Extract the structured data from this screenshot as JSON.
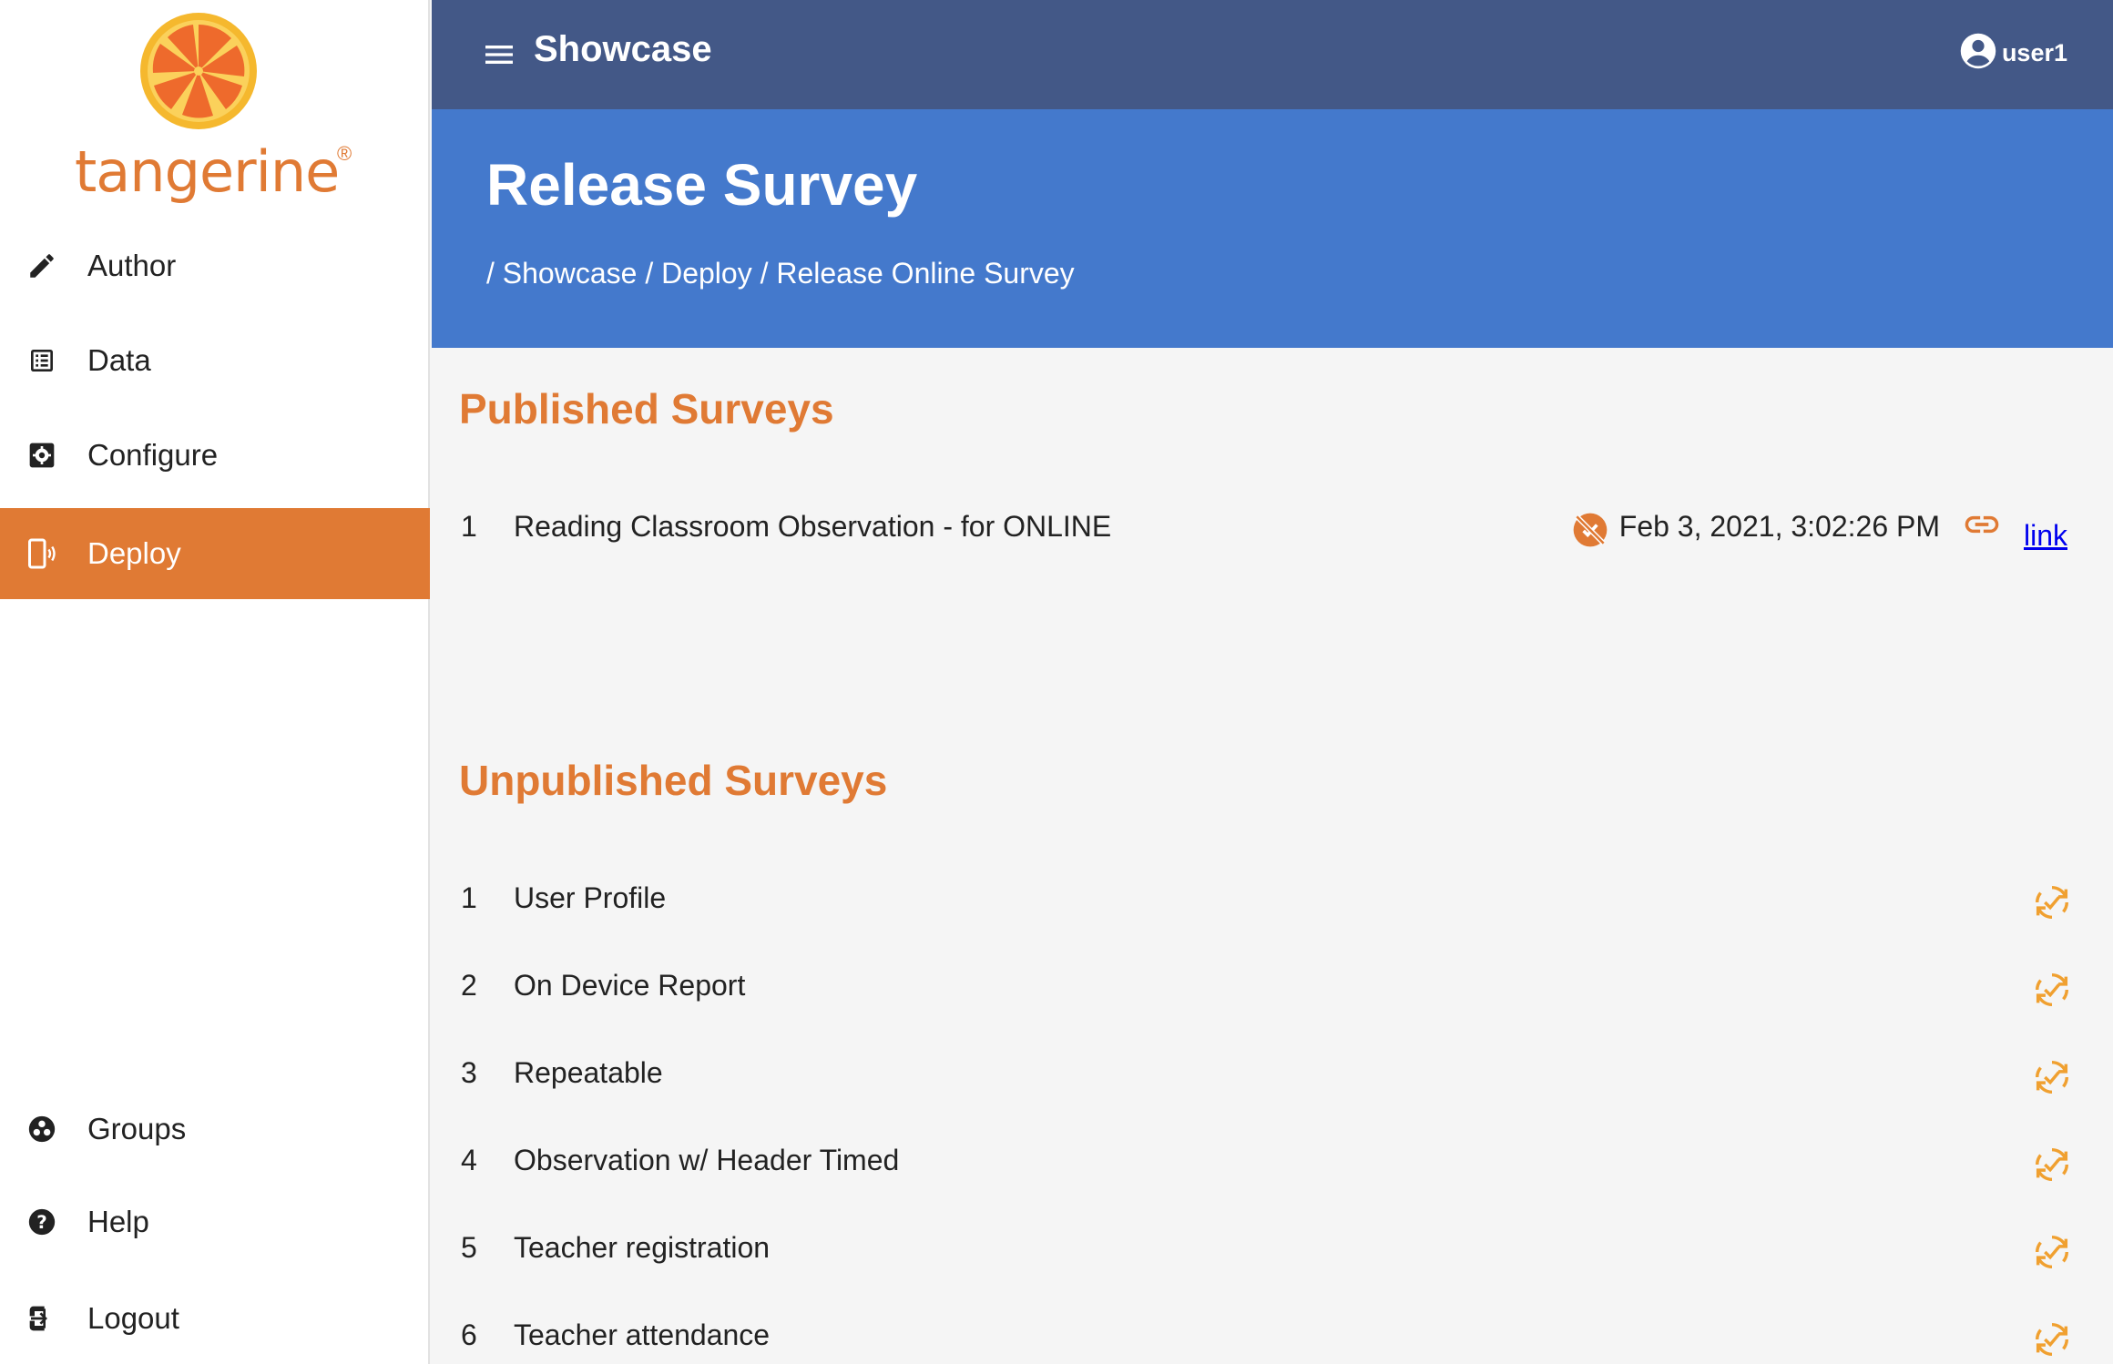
{
  "brand": {
    "logo_text": "tangerine",
    "registered_mark": "®",
    "logo_icon": "tangerine-slice-logo"
  },
  "colors": {
    "accent": "#e07a34",
    "topbar": "#435887",
    "banner": "#4479cc",
    "background": "#f5f5f5",
    "link": "#0000ee"
  },
  "sidebar": {
    "items": [
      {
        "label": "Author",
        "icon": "pencil-icon",
        "active": false
      },
      {
        "label": "Data",
        "icon": "list-icon",
        "active": false
      },
      {
        "label": "Configure",
        "icon": "gear-icon",
        "active": false
      },
      {
        "label": "Deploy",
        "icon": "device-icon",
        "active": true
      },
      {
        "label": "Groups",
        "icon": "groups-icon",
        "active": false
      },
      {
        "label": "Help",
        "icon": "help-icon",
        "active": false
      },
      {
        "label": "Logout",
        "icon": "logout-icon",
        "active": false
      }
    ]
  },
  "topbar": {
    "menu_icon": "hamburger-menu-icon",
    "app_name": "Showcase",
    "user_icon": "account-circle-icon",
    "username": "user1"
  },
  "banner": {
    "title": "Release Survey",
    "breadcrumb": {
      "separator": "/",
      "items": [
        "Showcase",
        "Deploy",
        "Release Online Survey"
      ]
    }
  },
  "published": {
    "title": "Published Surveys",
    "rows": [
      {
        "number": "1",
        "name": "Reading Classroom Observation - for ONLINE",
        "unpublish_icon": "unpublish-icon",
        "date": "Feb 3, 2021, 3:02:26 PM",
        "link_icon": "chain-link-icon",
        "link_label": "link"
      }
    ]
  },
  "unpublished": {
    "title": "Unpublished Surveys",
    "action_icon": "publish-sync-icon",
    "rows": [
      {
        "number": "1",
        "name": "User Profile"
      },
      {
        "number": "2",
        "name": "On Device Report"
      },
      {
        "number": "3",
        "name": "Repeatable"
      },
      {
        "number": "4",
        "name": "Observation w/ Header Timed"
      },
      {
        "number": "5",
        "name": "Teacher registration"
      },
      {
        "number": "6",
        "name": "Teacher attendance"
      }
    ]
  }
}
